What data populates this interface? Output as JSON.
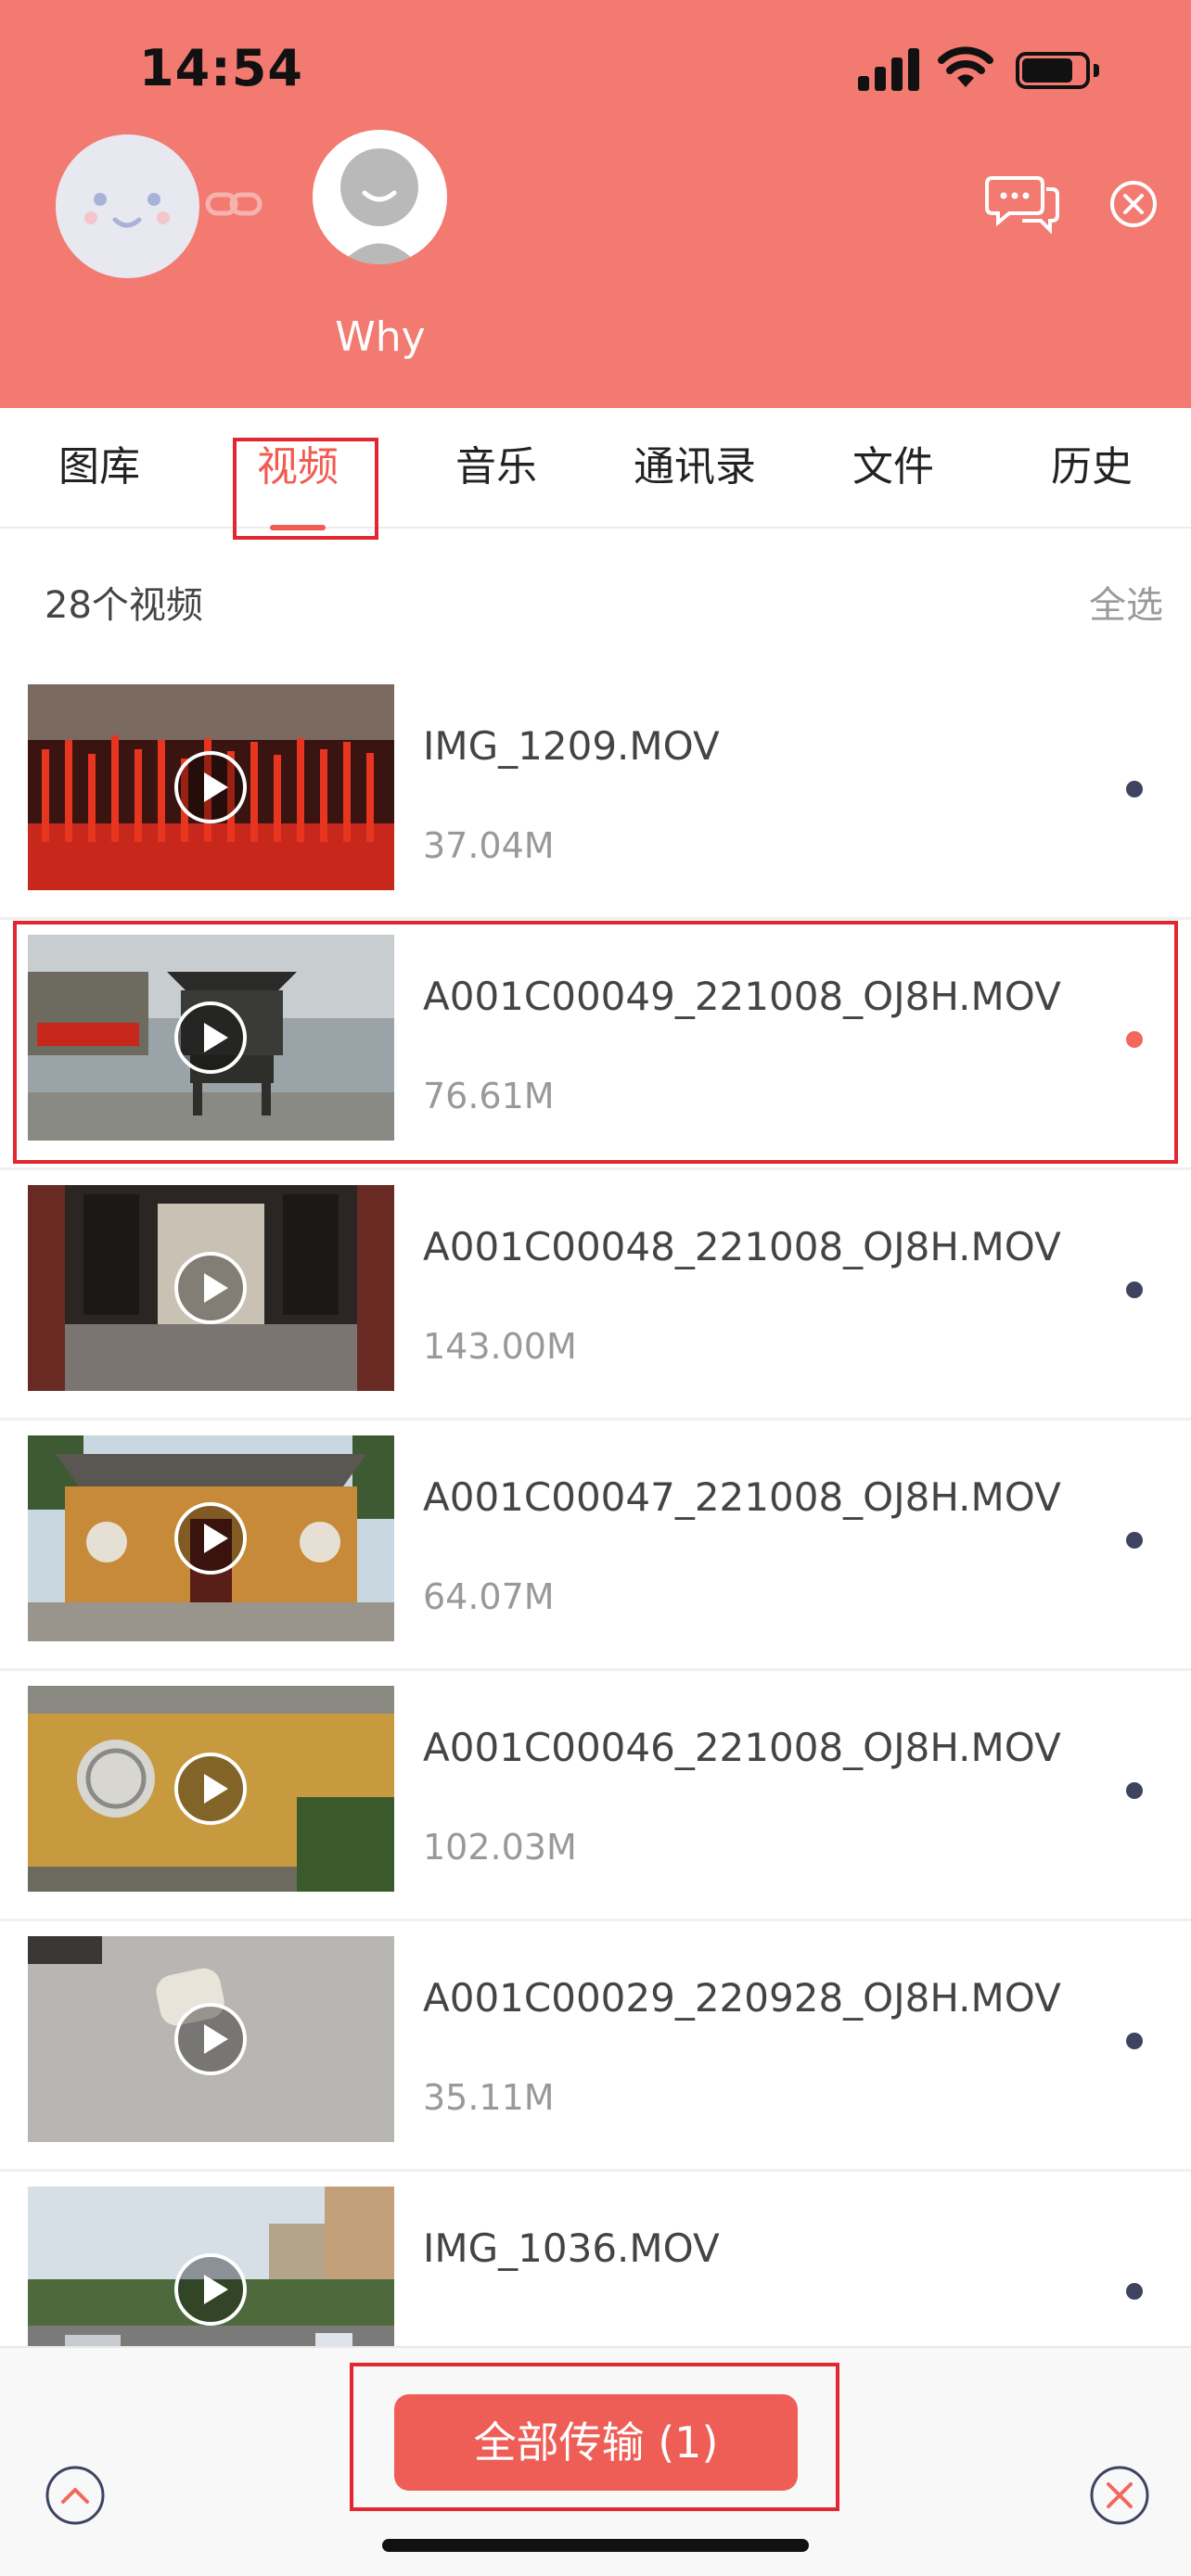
{
  "status_bar": {
    "time": "14:54"
  },
  "header": {
    "peer_name": "Why",
    "icons": [
      "face-avatar",
      "link-icon",
      "person-avatar",
      "chat-icon",
      "close-icon"
    ]
  },
  "tabs": [
    {
      "label": "图库"
    },
    {
      "label": "视频",
      "active": true
    },
    {
      "label": "音乐"
    },
    {
      "label": "通讯录"
    },
    {
      "label": "文件"
    },
    {
      "label": "历史"
    }
  ],
  "list_header": {
    "count_label": "28个视频",
    "select_all": "全选"
  },
  "videos": [
    {
      "name": "IMG_1209.MOV",
      "size": "37.04M",
      "selected": false
    },
    {
      "name": "A001C00049_221008_OJ8H.MOV",
      "size": "76.61M",
      "selected": true
    },
    {
      "name": "A001C00048_221008_OJ8H.MOV",
      "size": "143.00M",
      "selected": false
    },
    {
      "name": "A001C00047_221008_OJ8H.MOV",
      "size": "64.07M",
      "selected": false
    },
    {
      "name": "A001C00046_221008_OJ8H.MOV",
      "size": "102.03M",
      "selected": false
    },
    {
      "name": "A001C00029_220928_OJ8H.MOV",
      "size": "35.11M",
      "selected": false
    },
    {
      "name": "IMG_1036.MOV",
      "size": "",
      "selected": false
    }
  ],
  "bottom_bar": {
    "transfer_label": "全部传输 (1)"
  },
  "colors": {
    "accent": "#f27a70",
    "button": "#ee5e56",
    "highlight": "#e32630",
    "dot": "#3e4460"
  }
}
